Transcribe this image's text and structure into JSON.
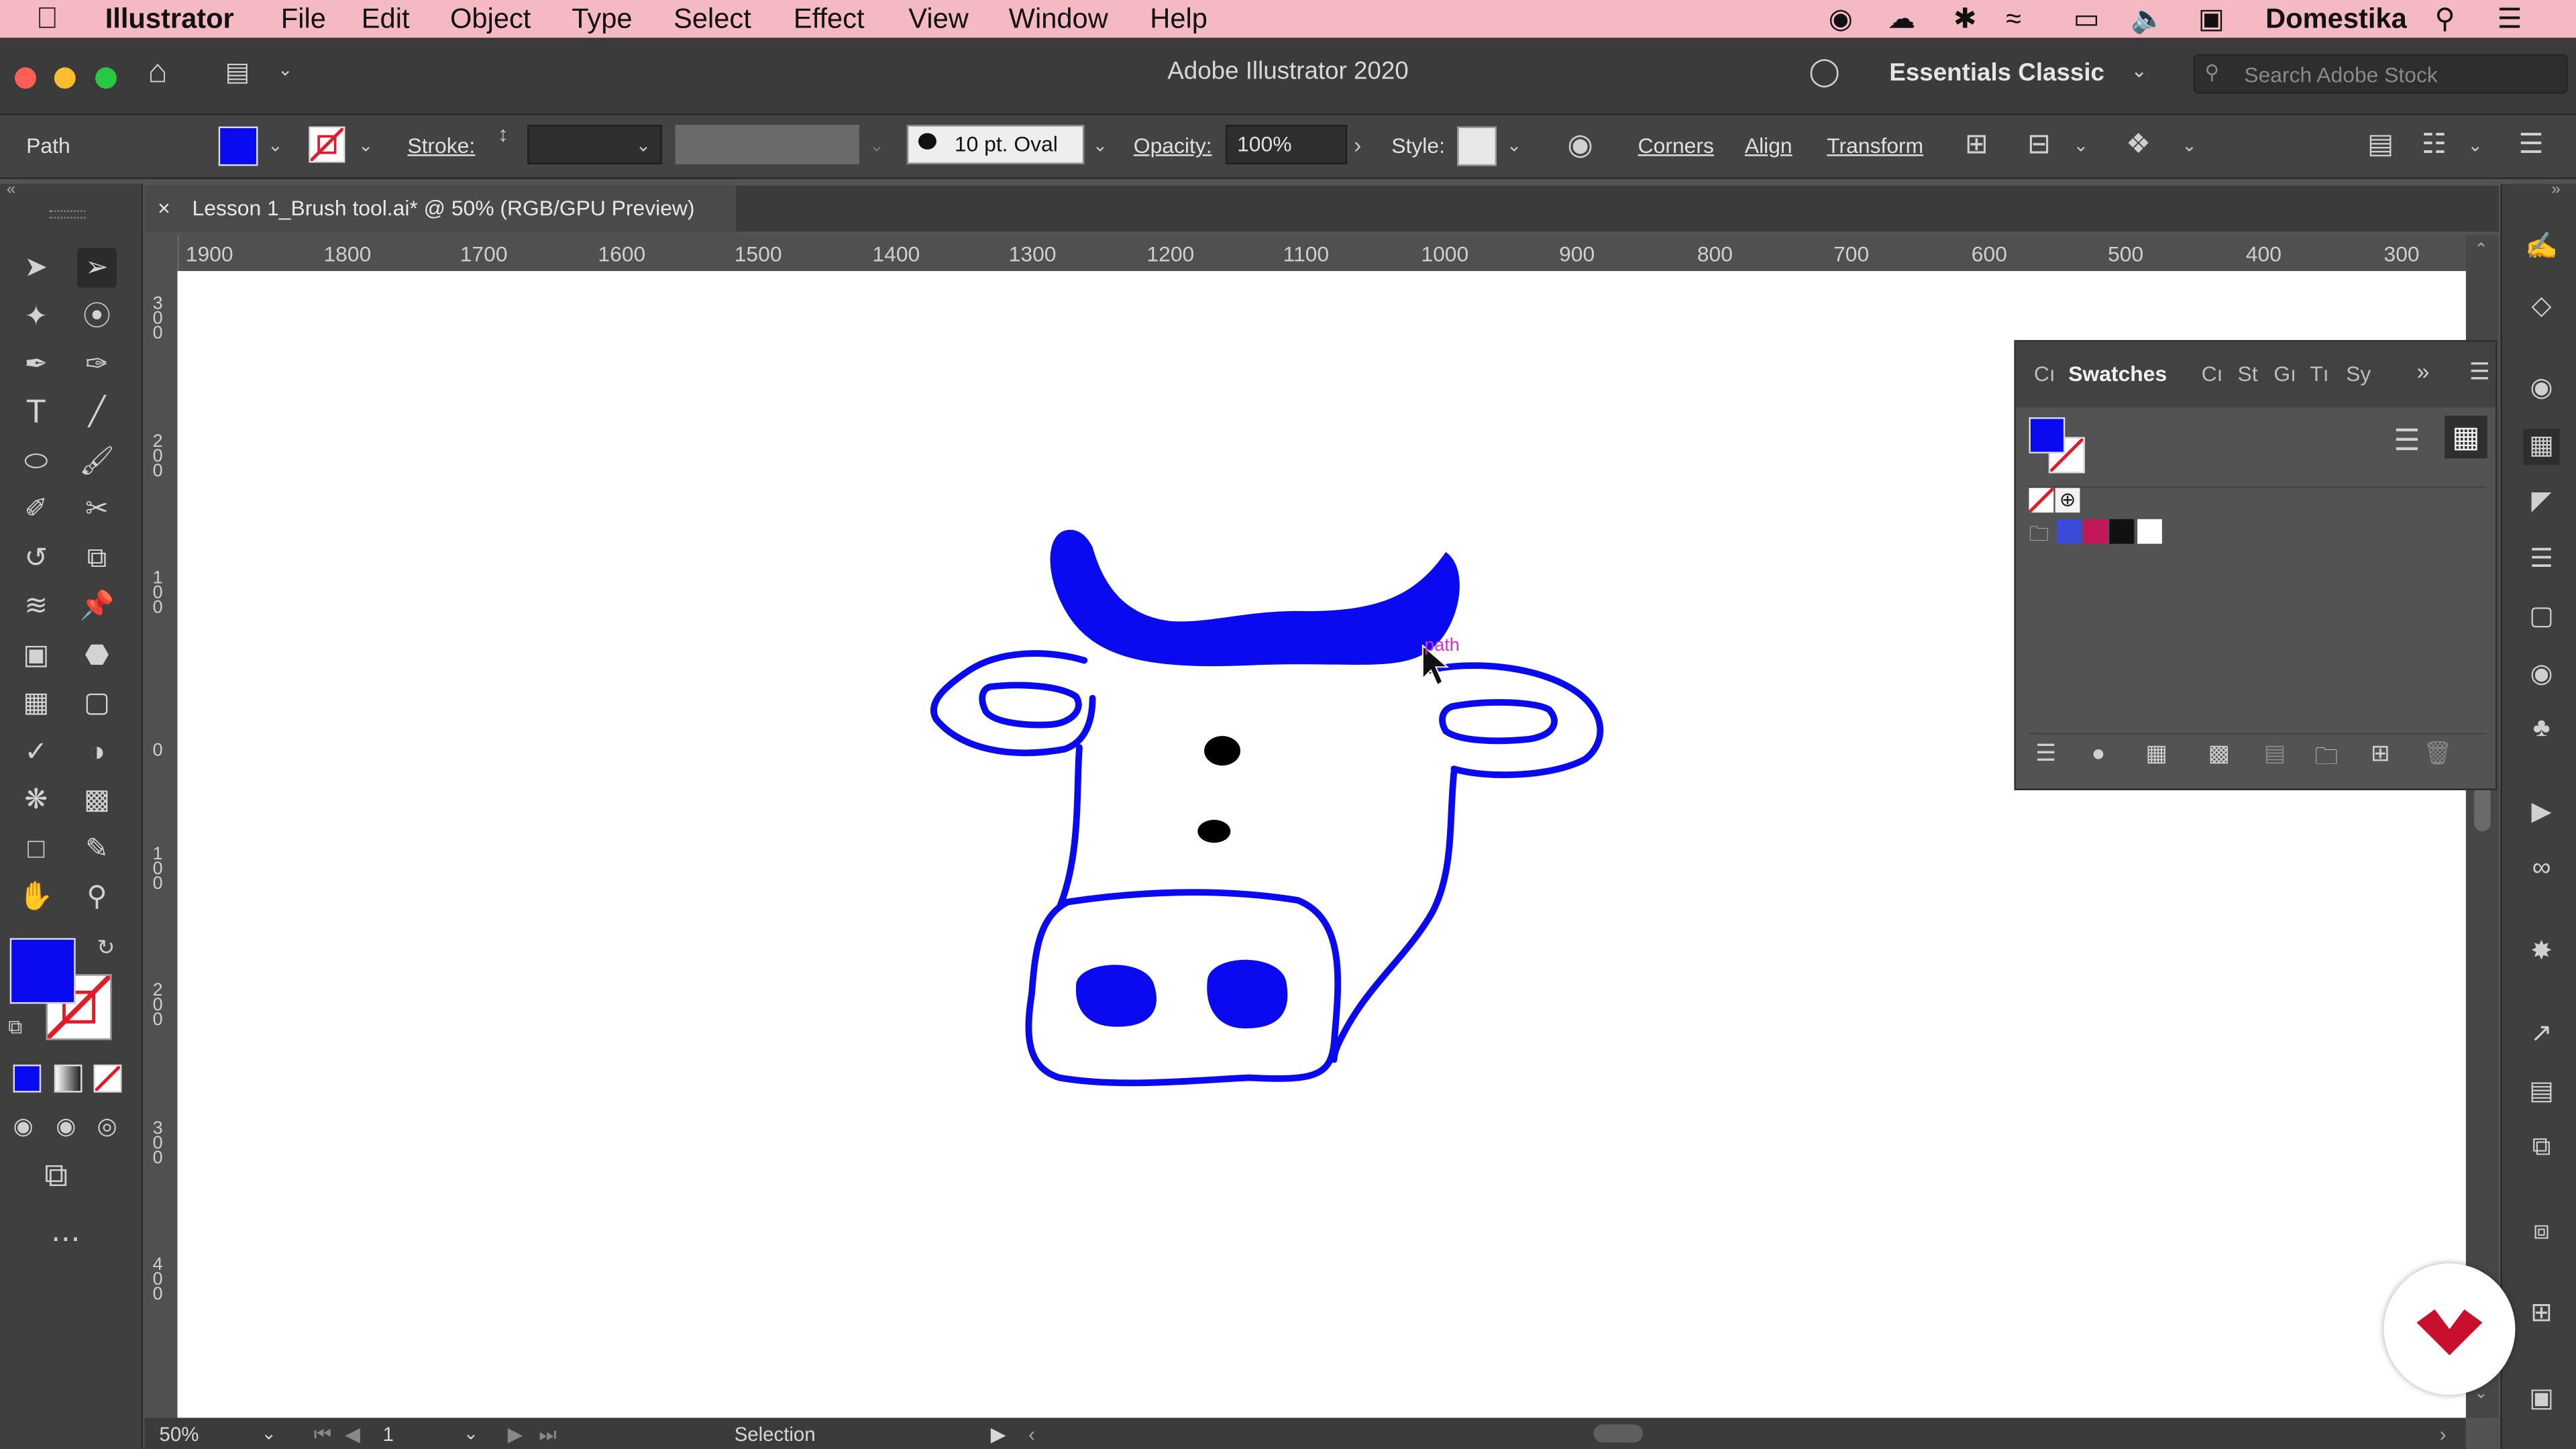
{
  "menubar": {
    "app": "Illustrator",
    "items": [
      "File",
      "Edit",
      "Object",
      "Type",
      "Select",
      "Effect",
      "View",
      "Window",
      "Help"
    ],
    "user": "Domestika"
  },
  "titlebar": {
    "title": "Adobe Illustrator 2020",
    "workspace": "Essentials Classic",
    "search_placeholder": "Search Adobe Stock"
  },
  "control": {
    "selection_type": "Path",
    "stroke_label": "Stroke:",
    "brush": "10 pt. Oval",
    "opacity_label": "Opacity:",
    "opacity_value": "100%",
    "style_label": "Style:",
    "corners": "Corners",
    "align": "Align",
    "transform": "Transform"
  },
  "document": {
    "tab_title": "Lesson 1_Brush tool.ai* @ 50% (RGB/GPU Preview)",
    "close_glyph": "×",
    "hover_tooltip": "path"
  },
  "rulers": {
    "horizontal": [
      "1900",
      "1800",
      "1700",
      "1600",
      "1500",
      "1400",
      "1300",
      "1200",
      "1100",
      "1000",
      "900",
      "800",
      "700",
      "600",
      "500",
      "400",
      "300"
    ],
    "vertical": [
      "300",
      "200",
      "100",
      "0",
      "100",
      "200",
      "300",
      "400"
    ]
  },
  "swatches_panel": {
    "tabs": [
      "Cı",
      "Swatches",
      "Cı",
      "St",
      "Gı",
      "Tı",
      "Sy"
    ],
    "active_tab": "Swatches"
  },
  "statusbar": {
    "zoom": "50%",
    "artboard": "1",
    "tool": "Selection"
  },
  "colors": {
    "fill": "#0a0af0",
    "accent_menu": "#f5b9c4",
    "brand": "#c8102e"
  }
}
